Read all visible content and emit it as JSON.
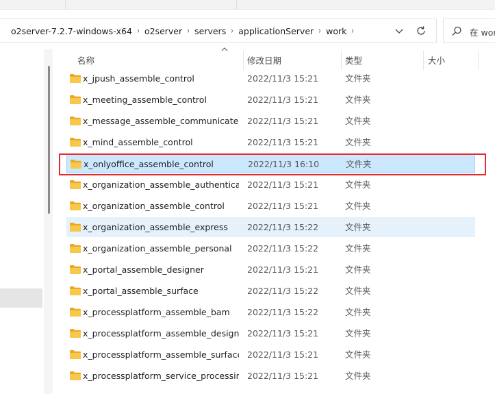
{
  "address": {
    "crumbs": [
      "o2server-7.2.7-windows-x64",
      "o2server",
      "servers",
      "applicationServer",
      "work"
    ],
    "separator": "›"
  },
  "search": {
    "placeholder": "在 wor"
  },
  "columns": {
    "name": "名称",
    "date": "修改日期",
    "type": "类型",
    "size": "大小"
  },
  "colors": {
    "selection": "#cce8ff",
    "hover": "#e5f1fb",
    "highlight_box": "#e52a2a",
    "folder": "#f5c542"
  },
  "rows": [
    {
      "name": "x_jpush_assemble_control",
      "date": "2022/11/3 15:21",
      "type": "文件夹"
    },
    {
      "name": "x_meeting_assemble_control",
      "date": "2022/11/3 15:21",
      "type": "文件夹"
    },
    {
      "name": "x_message_assemble_communicate",
      "date": "2022/11/3 15:21",
      "type": "文件夹"
    },
    {
      "name": "x_mind_assemble_control",
      "date": "2022/11/3 15:21",
      "type": "文件夹"
    },
    {
      "name": "x_onlyoffice_assemble_control",
      "date": "2022/11/3 16:10",
      "type": "文件夹",
      "state": "selected"
    },
    {
      "name": "x_organization_assemble_authenticati...",
      "date": "2022/11/3 15:21",
      "type": "文件夹"
    },
    {
      "name": "x_organization_assemble_control",
      "date": "2022/11/3 15:21",
      "type": "文件夹"
    },
    {
      "name": "x_organization_assemble_express",
      "date": "2022/11/3 15:22",
      "type": "文件夹",
      "state": "hover"
    },
    {
      "name": "x_organization_assemble_personal",
      "date": "2022/11/3 15:22",
      "type": "文件夹"
    },
    {
      "name": "x_portal_assemble_designer",
      "date": "2022/11/3 15:21",
      "type": "文件夹"
    },
    {
      "name": "x_portal_assemble_surface",
      "date": "2022/11/3 15:22",
      "type": "文件夹"
    },
    {
      "name": "x_processplatform_assemble_bam",
      "date": "2022/11/3 15:22",
      "type": "文件夹"
    },
    {
      "name": "x_processplatform_assemble_designer",
      "date": "2022/11/3 15:21",
      "type": "文件夹"
    },
    {
      "name": "x_processplatform_assemble_surface",
      "date": "2022/11/3 15:21",
      "type": "文件夹"
    },
    {
      "name": "x_processplatform_service_processing",
      "date": "2022/11/3 15:21",
      "type": "文件夹"
    }
  ]
}
